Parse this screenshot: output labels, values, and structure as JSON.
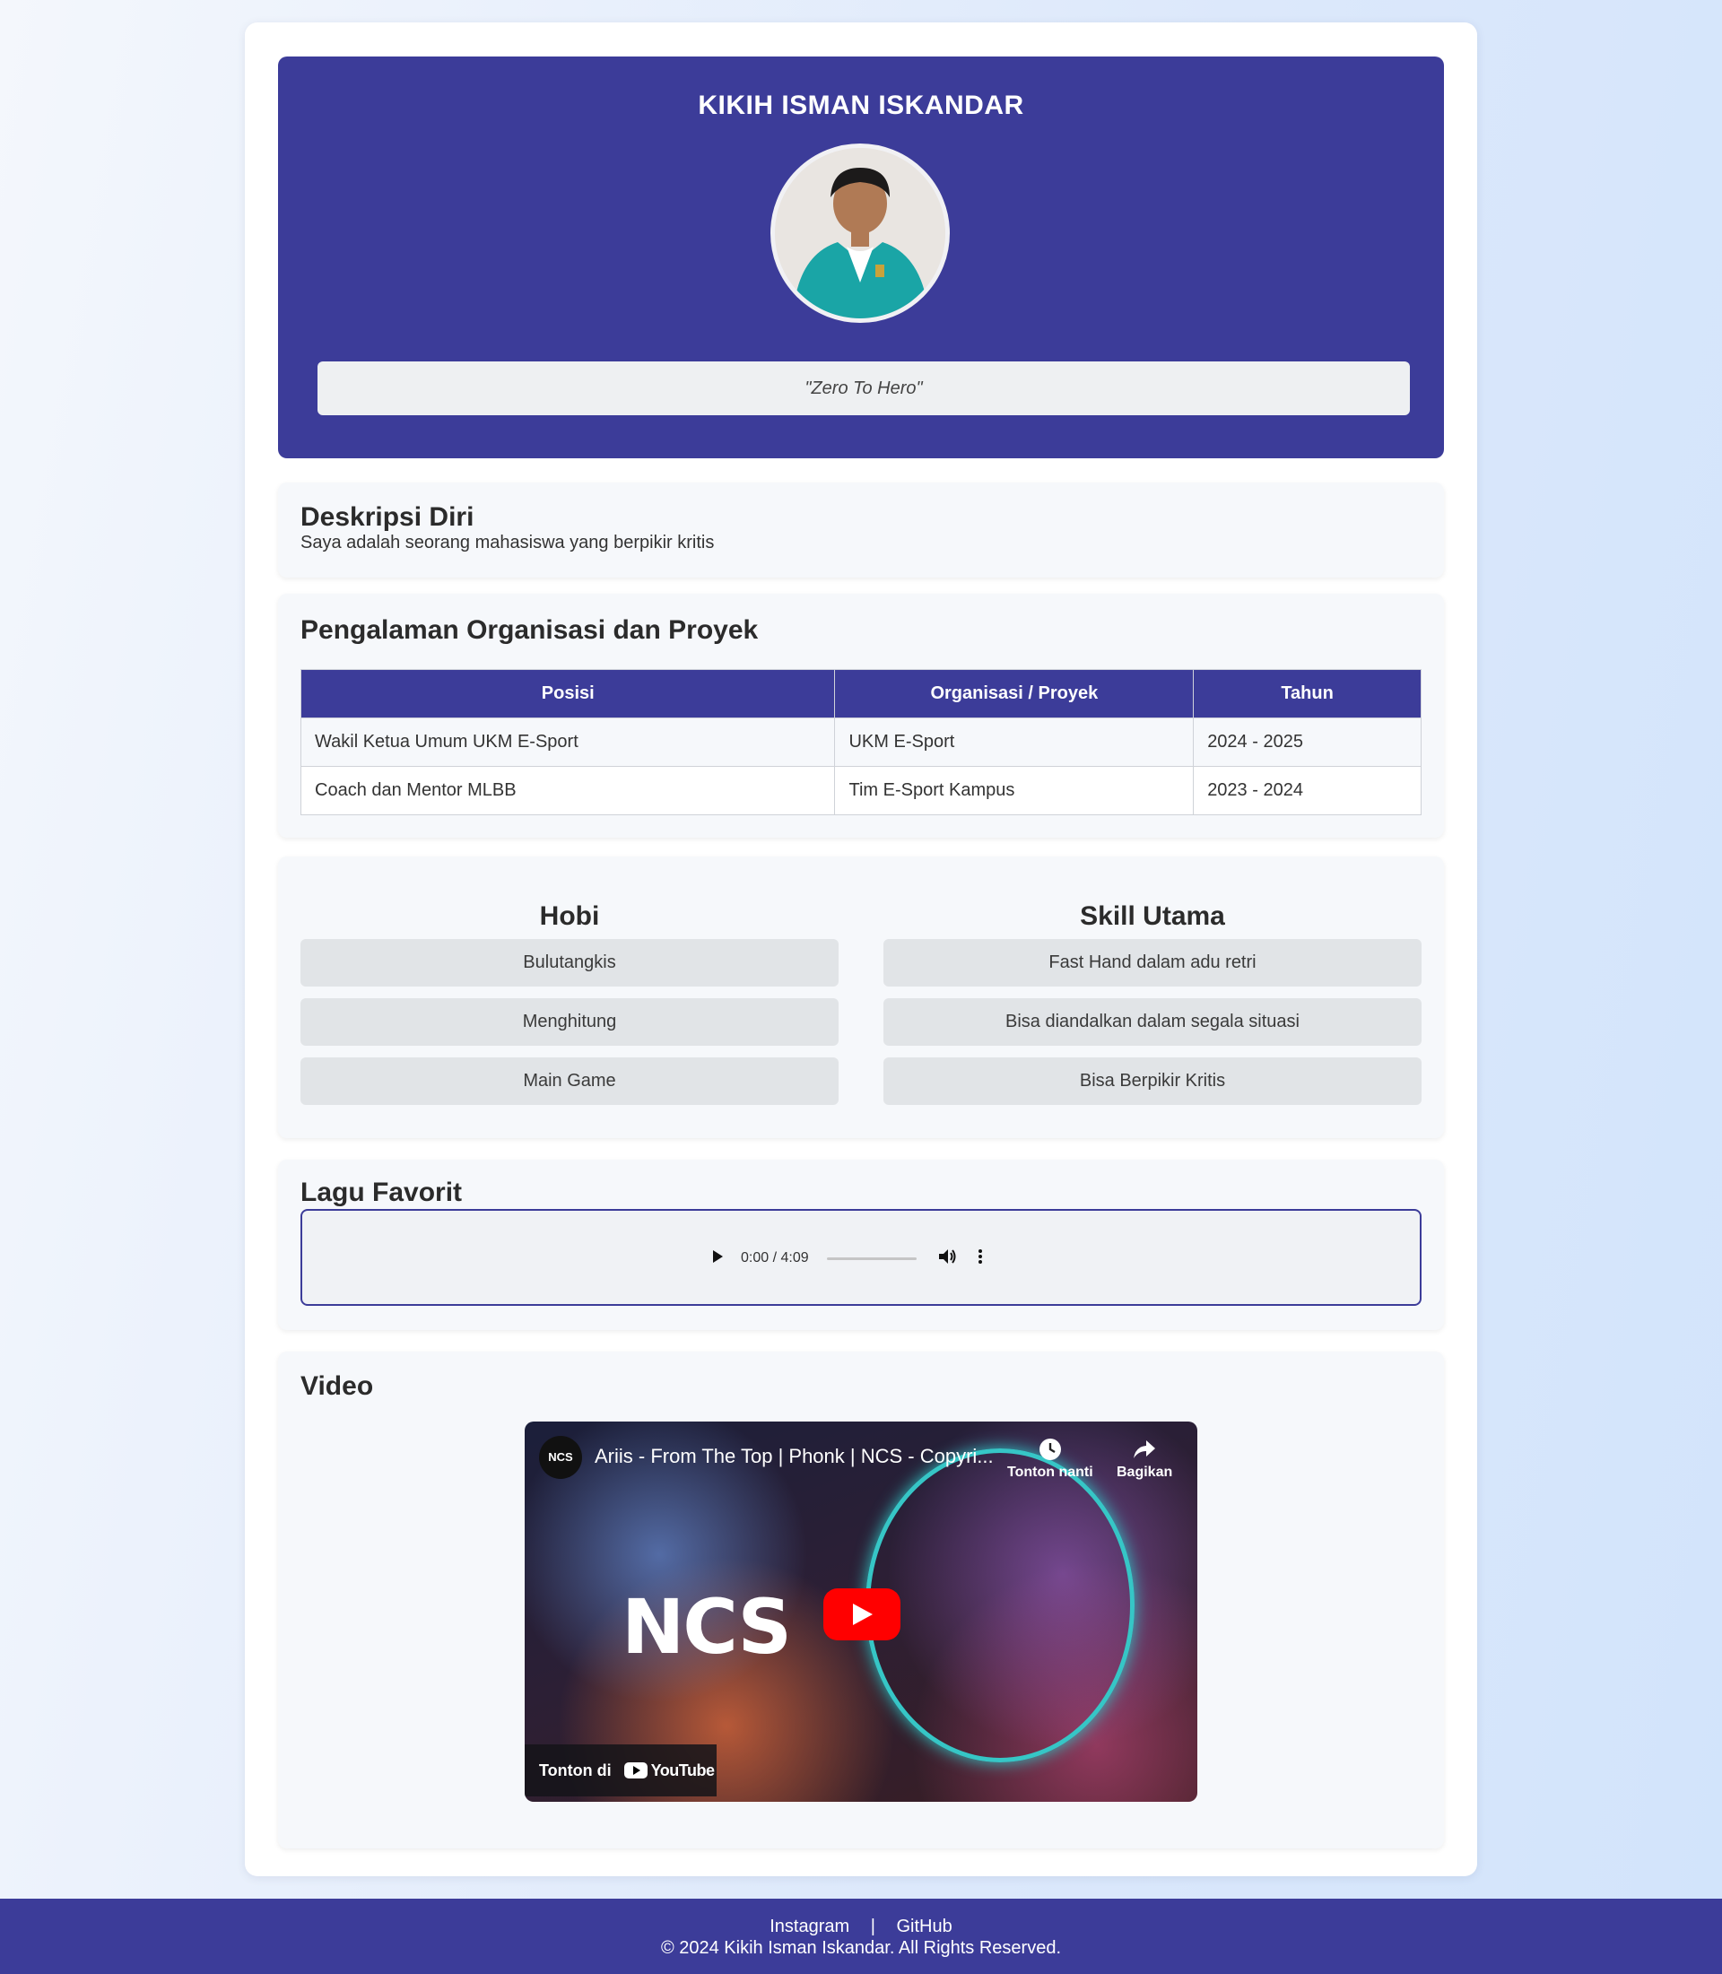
{
  "header": {
    "name": "KIKIH ISMAN ISKANDAR",
    "quote": "\"Zero To Hero\""
  },
  "description": {
    "title": "Deskripsi Diri",
    "text": "Saya adalah seorang mahasiswa yang berpikir kritis"
  },
  "experience": {
    "title": "Pengalaman Organisasi dan Proyek",
    "columns": [
      "Posisi",
      "Organisasi / Proyek",
      "Tahun"
    ],
    "rows": [
      [
        "Wakil Ketua Umum UKM E-Sport",
        "UKM E-Sport",
        "2024 - 2025"
      ],
      [
        "Coach dan Mentor MLBB",
        "Tim E-Sport Kampus",
        "2023 - 2024"
      ]
    ]
  },
  "hobbies": {
    "title": "Hobi",
    "items": [
      "Bulutangkis",
      "Menghitung",
      "Main Game"
    ]
  },
  "skills": {
    "title": "Skill Utama",
    "items": [
      "Fast Hand dalam adu retri",
      "Bisa diandalkan dalam segala situasi",
      "Bisa Berpikir Kritis"
    ]
  },
  "song": {
    "title": "Lagu Favorit",
    "time": "0:00 / 4:09"
  },
  "video": {
    "title": "Video",
    "channel_logo": "NCS",
    "video_title": "Ariis - From The Top | Phonk | NCS - Copyri...",
    "watch_later": "Tonton nanti",
    "share": "Bagikan",
    "thumb_text": "NCS",
    "watch_on": "Tonton di",
    "youtube_word": "YouTube"
  },
  "footer": {
    "instagram": "Instagram",
    "separator": "|",
    "github": "GitHub",
    "copyright": "© 2024 Kikih Isman Iskandar. All Rights Reserved."
  },
  "colors": {
    "accent": "#3c3c99",
    "play_red": "#ff0000"
  },
  "icons": [
    "play-icon",
    "volume-icon",
    "more-icon",
    "clock-icon",
    "share-icon",
    "youtube-icon"
  ]
}
